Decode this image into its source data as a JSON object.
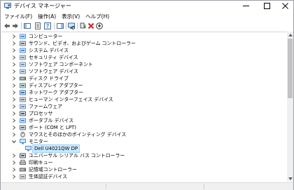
{
  "window": {
    "title": "デバイス マネージャー",
    "icon": "device-manager-icon",
    "controls": {
      "minimize": "─",
      "maximize": "☐",
      "close": "✕"
    }
  },
  "menubar": [
    {
      "label": "ファイル(F)"
    },
    {
      "label": "操作(A)"
    },
    {
      "label": "表示(V)"
    },
    {
      "label": "ヘルプ(H)"
    }
  ],
  "toolbar": [
    {
      "name": "back-icon"
    },
    {
      "name": "forward-icon"
    },
    {
      "name": "show-hide-console-tree-icon"
    },
    {
      "name": "properties-icon"
    },
    {
      "name": "help-icon"
    },
    {
      "name": "action-pane-icon"
    },
    {
      "name": "scan-hardware-icon"
    },
    {
      "name": "update-driver-icon"
    },
    {
      "name": "uninstall-device-icon"
    },
    {
      "name": "disable-device-icon"
    }
  ],
  "tree": [
    {
      "label": "コンピューター",
      "icon": "computer-icon",
      "expanded": false,
      "level": 0
    },
    {
      "label": "サウンド、ビデオ、およびゲーム コントローラー",
      "icon": "sound-icon",
      "expanded": false,
      "level": 0
    },
    {
      "label": "システム デバイス",
      "icon": "system-device-icon",
      "expanded": false,
      "level": 0
    },
    {
      "label": "セキュリティ デバイス",
      "icon": "security-device-icon",
      "expanded": false,
      "level": 0
    },
    {
      "label": "ソフトウェア コンポーネント",
      "icon": "software-component-icon",
      "expanded": false,
      "level": 0
    },
    {
      "label": "ソフトウェア デバイス",
      "icon": "software-device-icon",
      "expanded": false,
      "level": 0
    },
    {
      "label": "ディスク ドライブ",
      "icon": "disk-drive-icon",
      "expanded": false,
      "level": 0
    },
    {
      "label": "ディスプレイ アダプター",
      "icon": "display-adapter-icon",
      "expanded": false,
      "level": 0
    },
    {
      "label": "ネットワーク アダプター",
      "icon": "network-adapter-icon",
      "expanded": false,
      "level": 0
    },
    {
      "label": "ヒューマン インターフェイス デバイス",
      "icon": "hid-icon",
      "expanded": false,
      "level": 0
    },
    {
      "label": "ファームウェア",
      "icon": "firmware-icon",
      "expanded": false,
      "level": 0
    },
    {
      "label": "プロセッサ",
      "icon": "processor-icon",
      "expanded": false,
      "level": 0
    },
    {
      "label": "ポータブル デバイス",
      "icon": "portable-device-icon",
      "expanded": false,
      "level": 0
    },
    {
      "label": "ポート (COM と LPT)",
      "icon": "port-icon",
      "expanded": false,
      "level": 0
    },
    {
      "label": "マウスとそのほかのポインティング デバイス",
      "icon": "mouse-icon",
      "expanded": false,
      "level": 0
    },
    {
      "label": "モニター",
      "icon": "monitor-icon",
      "expanded": true,
      "level": 0
    },
    {
      "label": "Dell U4021QW DP",
      "icon": "monitor-icon",
      "expanded": null,
      "level": 1,
      "selected": true
    },
    {
      "label": "ユニバーサル シリアル バス コントローラー",
      "icon": "usb-icon",
      "expanded": false,
      "level": 0
    },
    {
      "label": "印刷キュー",
      "icon": "print-queue-icon",
      "expanded": false,
      "level": 0
    },
    {
      "label": "記憶域コントローラー",
      "icon": "storage-controller-icon",
      "expanded": false,
      "level": 0
    },
    {
      "label": "生体認証デバイス",
      "icon": "biometric-icon",
      "expanded": false,
      "level": 0
    }
  ],
  "colors": {
    "selection_fill": "#cce8ff",
    "selection_border": "#99d1ff",
    "folder_blue": "#4a8fd8",
    "delete_red": "#d11f1f",
    "update_green": "#1f8a3a"
  }
}
